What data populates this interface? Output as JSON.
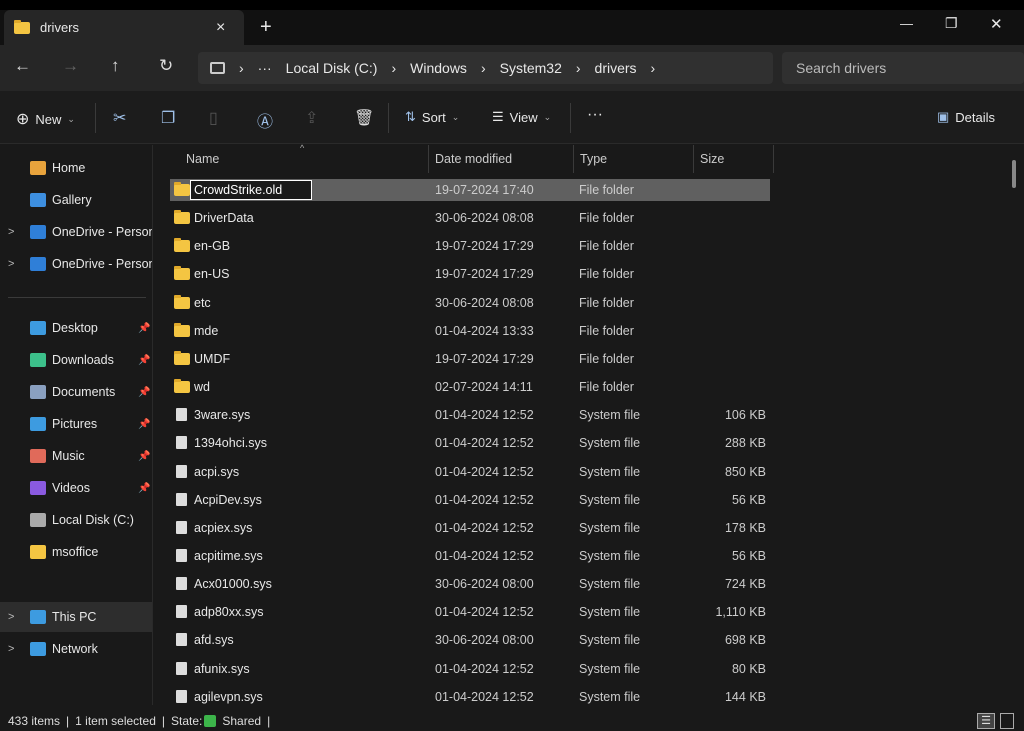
{
  "window": {
    "tab_title": "drivers",
    "close_tab": "×",
    "new_tab": "+",
    "minimize": "—",
    "maximize": "❐",
    "close": "✕"
  },
  "nav": {
    "back": "←",
    "forward": "→",
    "up": "↑",
    "refresh": "↻",
    "more": "···",
    "breadcrumb": [
      "Local Disk (C:)",
      "Windows",
      "System32",
      "drivers"
    ],
    "search_placeholder": "Search drivers"
  },
  "toolbar": {
    "new": "New",
    "sort": "Sort",
    "view": "View",
    "more": "···",
    "details": "Details"
  },
  "sidebar": {
    "items": [
      {
        "label": "Home",
        "icon": "home-icon",
        "color": "#e8a33c"
      },
      {
        "label": "Gallery",
        "icon": "gallery-icon",
        "color": "#3d8fe0"
      },
      {
        "label": "OneDrive - Persona",
        "icon": "cloud-icon",
        "color": "#2f7fd8",
        "expandable": true
      },
      {
        "label": "OneDrive - Persona",
        "icon": "cloud-icon",
        "color": "#2f7fd8",
        "expandable": true
      },
      {
        "label": "Desktop",
        "icon": "desktop-icon",
        "color": "#3d9be0",
        "pinned": true
      },
      {
        "label": "Downloads",
        "icon": "download-icon",
        "color": "#3cc08a",
        "pinned": true
      },
      {
        "label": "Documents",
        "icon": "documents-icon",
        "color": "#8aa0c0",
        "pinned": true
      },
      {
        "label": "Pictures",
        "icon": "pictures-icon",
        "color": "#3d9be0",
        "pinned": true
      },
      {
        "label": "Music",
        "icon": "music-icon",
        "color": "#e06a5a",
        "pinned": true
      },
      {
        "label": "Videos",
        "icon": "videos-icon",
        "color": "#8a5ae0",
        "pinned": true
      },
      {
        "label": "Local Disk (C:)",
        "icon": "drive-icon",
        "color": "#aaaaaa"
      },
      {
        "label": "msoffice",
        "icon": "folder-icon",
        "color": "#f4c542"
      },
      {
        "label": "This PC",
        "icon": "pc-icon",
        "color": "#3d9be0",
        "expandable": true,
        "selected": true
      },
      {
        "label": "Network",
        "icon": "network-icon",
        "color": "#3d9be0",
        "expandable": true
      }
    ]
  },
  "columns": {
    "name": "Name",
    "date": "Date modified",
    "type": "Type",
    "size": "Size"
  },
  "files": [
    {
      "name": "CrowdStrike.old",
      "date": "19-07-2024 17:40",
      "type": "File folder",
      "size": "",
      "folder": true,
      "renaming": true
    },
    {
      "name": "DriverData",
      "date": "30-06-2024 08:08",
      "type": "File folder",
      "size": "",
      "folder": true
    },
    {
      "name": "en-GB",
      "date": "19-07-2024 17:29",
      "type": "File folder",
      "size": "",
      "folder": true
    },
    {
      "name": "en-US",
      "date": "19-07-2024 17:29",
      "type": "File folder",
      "size": "",
      "folder": true
    },
    {
      "name": "etc",
      "date": "30-06-2024 08:08",
      "type": "File folder",
      "size": "",
      "folder": true
    },
    {
      "name": "mde",
      "date": "01-04-2024 13:33",
      "type": "File folder",
      "size": "",
      "folder": true
    },
    {
      "name": "UMDF",
      "date": "19-07-2024 17:29",
      "type": "File folder",
      "size": "",
      "folder": true
    },
    {
      "name": "wd",
      "date": "02-07-2024 14:11",
      "type": "File folder",
      "size": "",
      "folder": true
    },
    {
      "name": "3ware.sys",
      "date": "01-04-2024 12:52",
      "type": "System file",
      "size": "106 KB"
    },
    {
      "name": "1394ohci.sys",
      "date": "01-04-2024 12:52",
      "type": "System file",
      "size": "288 KB"
    },
    {
      "name": "acpi.sys",
      "date": "01-04-2024 12:52",
      "type": "System file",
      "size": "850 KB"
    },
    {
      "name": "AcpiDev.sys",
      "date": "01-04-2024 12:52",
      "type": "System file",
      "size": "56 KB"
    },
    {
      "name": "acpiex.sys",
      "date": "01-04-2024 12:52",
      "type": "System file",
      "size": "178 KB"
    },
    {
      "name": "acpitime.sys",
      "date": "01-04-2024 12:52",
      "type": "System file",
      "size": "56 KB"
    },
    {
      "name": "Acx01000.sys",
      "date": "30-06-2024 08:00",
      "type": "System file",
      "size": "724 KB"
    },
    {
      "name": "adp80xx.sys",
      "date": "01-04-2024 12:52",
      "type": "System file",
      "size": "1,110 KB"
    },
    {
      "name": "afd.sys",
      "date": "30-06-2024 08:00",
      "type": "System file",
      "size": "698 KB"
    },
    {
      "name": "afunix.sys",
      "date": "01-04-2024 12:52",
      "type": "System file",
      "size": "80 KB"
    },
    {
      "name": "agilevpn.sys",
      "date": "01-04-2024 12:52",
      "type": "System file",
      "size": "144 KB"
    }
  ],
  "status": {
    "items": "433 items",
    "selected": "1 item selected",
    "state_label": "State:",
    "state": "Shared"
  }
}
